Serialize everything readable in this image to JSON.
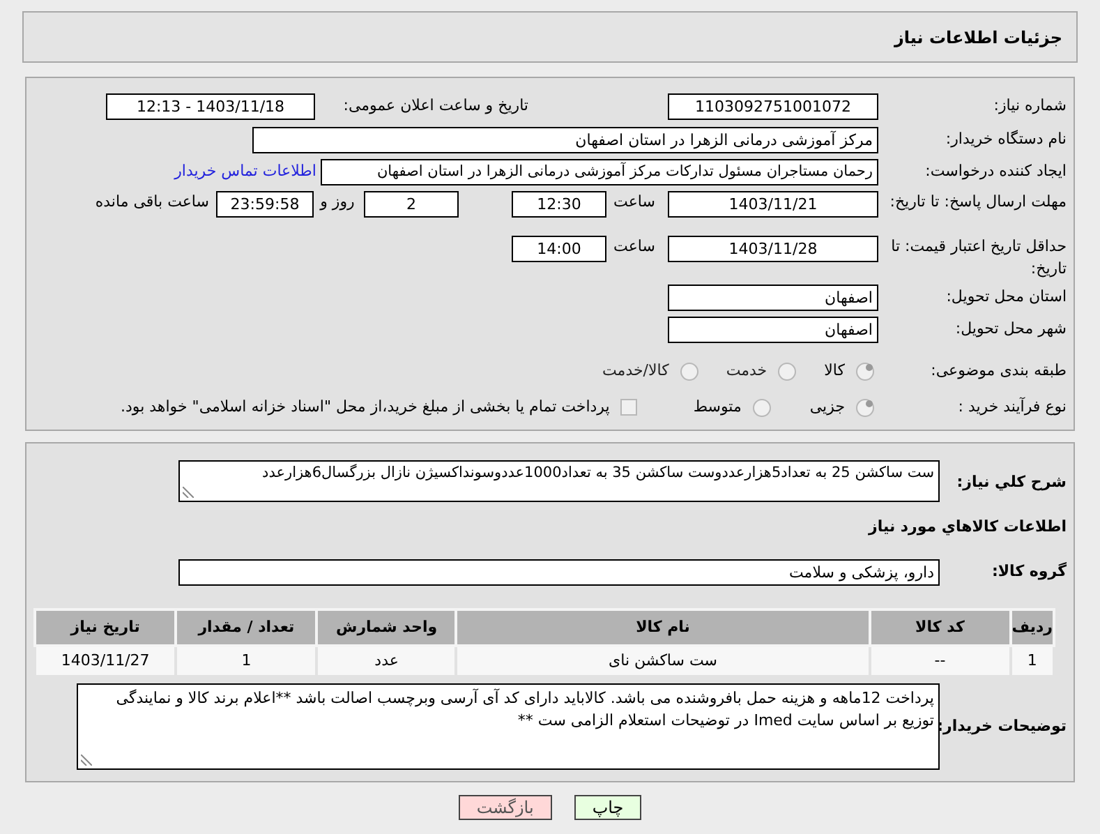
{
  "header": {
    "title": "جزئیات اطلاعات نیاز"
  },
  "need_number": {
    "label": "شماره نیاز:",
    "value": "1103092751001072"
  },
  "announce": {
    "label": "تاریخ و ساعت اعلان عمومی:",
    "value": "1403/11/18 - 12:13"
  },
  "buyer_org": {
    "label": "نام دستگاه خریدار:",
    "value": "مرکز آموزشی درمانی الزهرا در استان اصفهان"
  },
  "requester": {
    "label": "ایجاد کننده درخواست:",
    "value": "رحمان مستاجران مسئول تدارکات مرکز آموزشی درمانی الزهرا در استان اصفهان",
    "link": "اطلاعات تماس خریدار"
  },
  "reply_deadline": {
    "label": "مهلت ارسال پاسخ: تا تاریخ:",
    "date": "1403/11/21",
    "time_label": "ساعت",
    "time": "12:30",
    "days": "2",
    "days_label": "روز و",
    "remaining": "23:59:58",
    "remaining_label": "ساعت باقی مانده"
  },
  "price_validity": {
    "label": "حداقل تاریخ اعتبار قیمت: تا تاریخ:",
    "date": "1403/11/28",
    "time_label": "ساعت",
    "time": "14:00"
  },
  "province": {
    "label": "استان محل تحویل:",
    "value": "اصفهان"
  },
  "city": {
    "label": "شهر محل تحویل:",
    "value": "اصفهان"
  },
  "category": {
    "label": "طبقه بندی موضوعی:",
    "options": [
      {
        "label": "کالا",
        "selected": true
      },
      {
        "label": "خدمت",
        "selected": false
      },
      {
        "label": "کالا/خدمت",
        "selected": false
      }
    ]
  },
  "process": {
    "label": "نوع فرآیند خرید :",
    "options": [
      {
        "label": "جزیی",
        "selected": true
      },
      {
        "label": "متوسط",
        "selected": false
      }
    ],
    "payment": {
      "checked": false,
      "text": "پرداخت تمام یا بخشی از مبلغ خرید،از محل \"اسناد خزانه اسلامی\" خواهد بود."
    }
  },
  "description": {
    "label": "شرح کلي نياز:",
    "value": "ست ساکشن 25 به تعداد5هزارعددوست ساکشن 35 به تعداد1000عددوسونداکسیژن نازال بزرگسال6هزارعدد"
  },
  "goods_heading": "اطلاعات کالاهاي مورد نياز",
  "goods_group": {
    "label": "گروه کالا:",
    "value": "دارو، پزشکی و سلامت"
  },
  "table": {
    "columns": [
      "ردیف",
      "کد کالا",
      "نام کالا",
      "واحد شمارش",
      "تعداد / مقدار",
      "تاریخ نیاز"
    ],
    "rows": [
      [
        "1",
        "--",
        "ست ساکشن نای",
        "عدد",
        "1",
        "1403/11/27"
      ]
    ]
  },
  "buyer_notes": {
    "label": "توضیحات خریدار:",
    "value": "پرداخت 12ماهه و  هزینه حمل بافروشنده می باشد. کالاباید دارای کد آی آرسی وبرچسب اصالت باشد **اعلام برند کالا و نمایندگی توزیع بر اساس سایت Imed در توضیحات استعلام الزامی ست **"
  },
  "buttons": [
    {
      "label": "چاپ",
      "kind": "print"
    },
    {
      "label": "بازگشت",
      "kind": "back"
    }
  ]
}
